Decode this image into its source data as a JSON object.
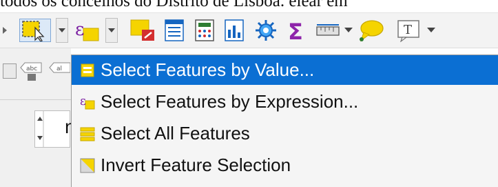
{
  "document": {
    "header_text": "todos os concelhos do Distrito de Lisboa. elear em"
  },
  "toolbar": {
    "icons": [
      "select-rectangle-icon",
      "select-by-expression-icon",
      "deselect-features-icon",
      "attribute-table-icon",
      "field-calculator-icon",
      "processing-toolbox-icon",
      "statistical-summary-icon",
      "measure-line-icon",
      "map-tips-icon",
      "text-annotation-icon"
    ],
    "colors": {
      "bg": "#f3f3f3",
      "yellow": "#f5d400",
      "blue": "#1565c0",
      "red": "#d32f2f",
      "purple": "#7b1fa2",
      "green": "#2e7d32"
    }
  },
  "left_panel": {
    "abc_label_1": "abc",
    "abc_label_2": "al",
    "spin_text": "n"
  },
  "menu": {
    "items": [
      {
        "label": "Select Features by Value...",
        "icon": "form-select-icon",
        "highlighted": true
      },
      {
        "label": "Select Features by Expression...",
        "icon": "epsilon-icon",
        "highlighted": false
      },
      {
        "label": "Select All Features",
        "icon": "select-all-icon",
        "highlighted": false
      },
      {
        "label": "Invert Feature Selection",
        "icon": "invert-selection-icon",
        "highlighted": false
      }
    ],
    "highlight_color": "#0b6fd3"
  }
}
